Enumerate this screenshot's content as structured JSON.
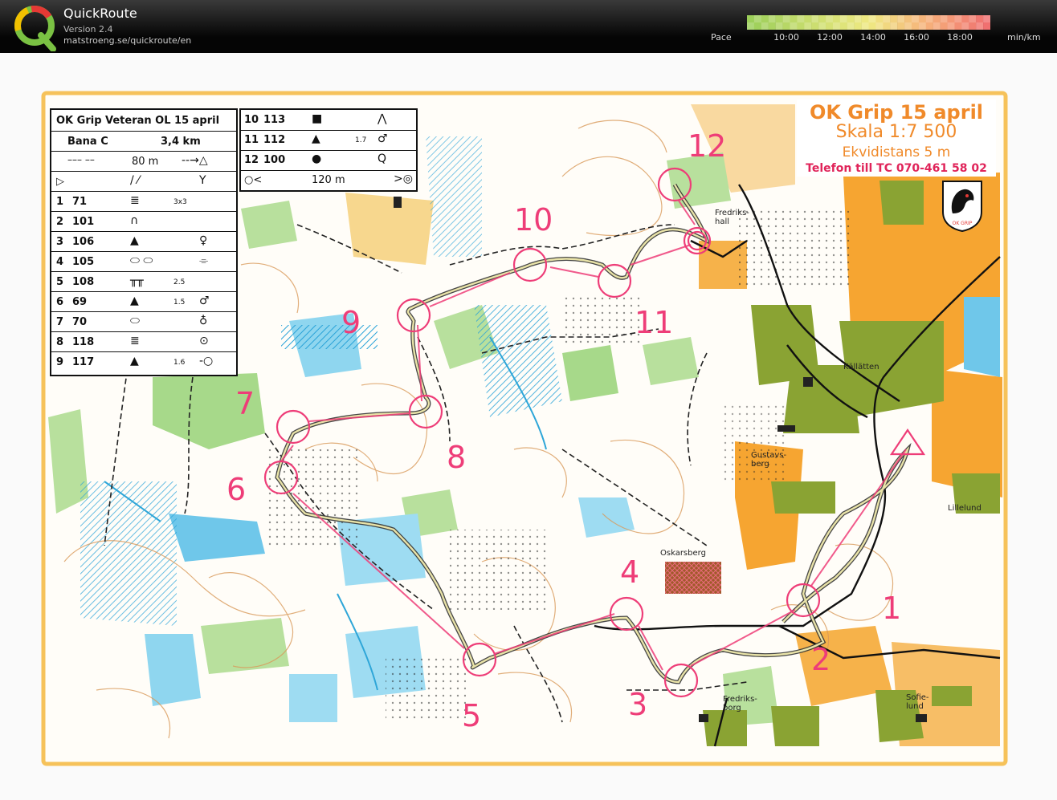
{
  "app": {
    "name": "QuickRoute",
    "version": "Version 2.4",
    "url": "matstroeng.se/quickroute/en"
  },
  "pace": {
    "label": "Pace",
    "ticks": [
      "10:00",
      "12:00",
      "14:00",
      "16:00",
      "18:00"
    ],
    "unit": "min/km",
    "colors": [
      "#9ccf5a",
      "#c9dd6e",
      "#efe982",
      "#f6b07a",
      "#f07070"
    ]
  },
  "map": {
    "title": "OK Grip 15 april",
    "scale": "Skala 1:7 500",
    "equidistance": "Ekvidistans 5 m",
    "phone": "Telefon till TC 070-461 58 02",
    "club_logo_text": "OK GRIP",
    "colors": {
      "course": "#ee3d78",
      "route": "#2a2a2a",
      "open": "#f7c87a",
      "field": "#f29b1f",
      "forest_green": "#9ad17a",
      "water": "#3bb3de",
      "settlement": "#8aa333",
      "contour": "#d99a5a"
    },
    "places": [
      "Fredriks-hall",
      "Källätten",
      "Gustavs-berg",
      "Lillelund",
      "Oskarsberg",
      "Fredriks-borg",
      "Sofie-lund"
    ]
  },
  "control_description": {
    "event": "OK Grip Veteran OL 15 april",
    "course": "Bana C",
    "length": "3,4 km",
    "start_distance": "80 m",
    "finish_distance": "120 m",
    "controls": [
      {
        "num": "1",
        "code": "71",
        "feature": "≣",
        "dim": "3x3",
        "extra": ""
      },
      {
        "num": "2",
        "code": "101",
        "feature": "∩",
        "dim": "",
        "extra": ""
      },
      {
        "num": "3",
        "code": "106",
        "feature": "▲",
        "dim": "",
        "extra": "♀"
      },
      {
        "num": "4",
        "code": "105",
        "feature": "⬭ ⬭",
        "dim": "",
        "extra": "⌯"
      },
      {
        "num": "5",
        "code": "108",
        "feature": "╥╥",
        "dim": "2.5",
        "extra": ""
      },
      {
        "num": "6",
        "code": "69",
        "feature": "▲",
        "dim": "1.5",
        "extra": "♂"
      },
      {
        "num": "7",
        "code": "70",
        "feature": "⬭",
        "dim": "",
        "extra": "♁"
      },
      {
        "num": "8",
        "code": "118",
        "feature": "≣",
        "dim": "",
        "extra": "⊙"
      },
      {
        "num": "9",
        "code": "117",
        "feature": "▲",
        "dim": "1.6",
        "extra": "-○"
      },
      {
        "num": "10",
        "code": "113",
        "feature": "■",
        "dim": "",
        "extra": "⋀"
      },
      {
        "num": "11",
        "code": "112",
        "feature": "▲",
        "dim": "1.7",
        "extra": "♂"
      },
      {
        "num": "12",
        "code": "100",
        "feature": "●",
        "dim": "",
        "extra": "Q"
      }
    ]
  },
  "course_controls": [
    "1",
    "2",
    "3",
    "4",
    "5",
    "6",
    "7",
    "8",
    "9",
    "10",
    "11",
    "12"
  ]
}
